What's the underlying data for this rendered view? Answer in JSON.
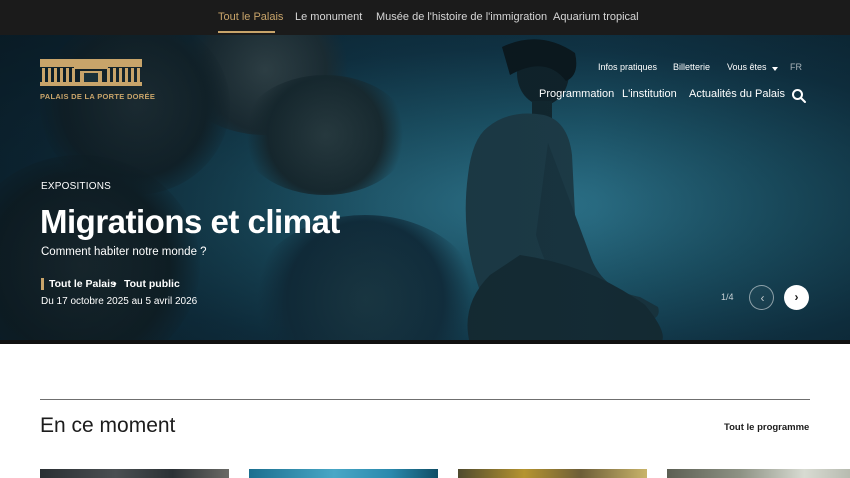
{
  "site_tabs": [
    "Tout le Palais",
    "Le monument",
    "Musée de l'histoire de l'immigration",
    "Aquarium tropical"
  ],
  "active_tab": "Tout le Palais",
  "logo": {
    "text": "PALAIS DE LA PORTE DORÉE"
  },
  "utility_nav": {
    "infos": "Infos pratiques",
    "billetterie": "Billetterie",
    "vous_etes": "Vous êtes",
    "lang": "FR"
  },
  "main_nav": [
    "Programmation",
    "L'institution",
    "Actualités du Palais"
  ],
  "hero": {
    "kicker": "EXPOSITIONS",
    "title": "Migrations et climat",
    "subtitle": "Comment habiter notre monde ?",
    "tag_location": "Tout le Palais",
    "tag_separator": "•",
    "tag_audience": "Tout public",
    "dates": "Du 17 octobre 2025 au 5 avril 2026",
    "counter": "1/4",
    "prev_glyph": "‹",
    "next_glyph": "›"
  },
  "section": {
    "title": "En ce moment",
    "link": "Tout le programme"
  },
  "colors": {
    "gold": "#c8a46a",
    "topbar": "#1b1b1b",
    "hero_teal": "#1c5468"
  },
  "icons": {
    "search": "search-icon",
    "caret": "caret-down-icon",
    "prev": "chevron-left-icon",
    "next": "chevron-right-icon"
  }
}
